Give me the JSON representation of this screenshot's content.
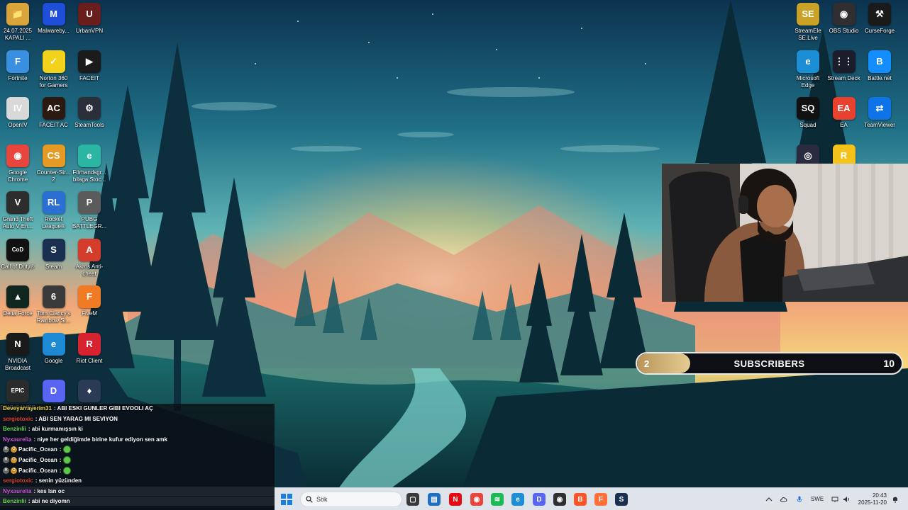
{
  "desktop": {
    "left_icons": [
      {
        "label": "24.07.2025 KAPALI ...",
        "icon": "folder-icon",
        "color": "#d9a53a",
        "glyph": "📁"
      },
      {
        "label": "Malwareby...",
        "icon": "malwarebytes-icon",
        "color": "#1f4fd8",
        "glyph": "M"
      },
      {
        "label": "UrbanVPN",
        "icon": "urbanvpn-icon",
        "color": "#6a1d1d",
        "glyph": "U"
      },
      {
        "label": "Fortnite",
        "icon": "fortnite-icon",
        "color": "#3a8fe0",
        "glyph": "F"
      },
      {
        "label": "Norton 360 for Gamers",
        "icon": "norton-icon",
        "color": "#f2d21a",
        "glyph": "✓"
      },
      {
        "label": "FACEIT",
        "icon": "faceit-icon",
        "color": "#1b1b1b",
        "glyph": "▶"
      },
      {
        "label": "OpenIV",
        "icon": "openiv-icon",
        "color": "#d9d9d9",
        "glyph": "IV"
      },
      {
        "label": "FACEIT AC",
        "icon": "faceit-ac-icon",
        "color": "#2b1a12",
        "glyph": "AC"
      },
      {
        "label": "SteamTools",
        "icon": "steamtools-icon",
        "color": "#2a2f3a",
        "glyph": "⚙"
      },
      {
        "label": "Google Chrome",
        "icon": "chrome-icon",
        "color": "#e8453c",
        "glyph": "◉"
      },
      {
        "label": "Counter-Str... 2",
        "icon": "cs2-icon",
        "color": "#e49a25",
        "glyph": "CS"
      },
      {
        "label": "Förhandsgr... bilaga Stoc...",
        "icon": "edge-icon",
        "color": "#2bb5a3",
        "glyph": "e"
      },
      {
        "label": "Grand Theft Auto V En...",
        "icon": "gta-icon",
        "color": "#2d2d2d",
        "glyph": "V"
      },
      {
        "label": "Rocket League®",
        "icon": "rocket-league-icon",
        "color": "#2a6fd1",
        "glyph": "RL"
      },
      {
        "label": "PUBG BATTLEGR...",
        "icon": "pubg-icon",
        "color": "#5b5b5b",
        "glyph": "P"
      },
      {
        "label": "Call of Duty®",
        "icon": "cod-icon",
        "color": "#111111",
        "glyph": "CoD"
      },
      {
        "label": "Steam",
        "icon": "steam-icon",
        "color": "#1b3050",
        "glyph": "S"
      },
      {
        "label": "Akros Anti-cheat",
        "icon": "akros-icon",
        "color": "#d43c2b",
        "glyph": "A"
      },
      {
        "label": "Delta Force",
        "icon": "delta-force-icon",
        "color": "#10271f",
        "glyph": "▲"
      },
      {
        "label": "Tom Clancy's Rainbow Si...",
        "icon": "rainbow-six-icon",
        "color": "#3a3a3a",
        "glyph": "6"
      },
      {
        "label": "FiveM",
        "icon": "fivem-icon",
        "color": "#f07b24",
        "glyph": "F"
      },
      {
        "label": "NVIDIA Broadcast",
        "icon": "nvidia-icon",
        "color": "#1a1a1a",
        "glyph": "N"
      },
      {
        "label": "Google",
        "icon": "edge-google-icon",
        "color": "#1f8ad4",
        "glyph": "e"
      },
      {
        "label": "Riot Client",
        "icon": "riot-icon",
        "color": "#d6232f",
        "glyph": "R"
      },
      {
        "label": "EPIC GAMES",
        "icon": "epic-icon",
        "color": "#2b2b2b",
        "glyph": "EPIC"
      },
      {
        "label": "",
        "icon": "discord-icon",
        "color": "#5865f2",
        "glyph": "D"
      },
      {
        "label": "",
        "icon": "rocket-game-icon",
        "color": "#2b3a55",
        "glyph": "♦"
      }
    ],
    "right_icons": [
      {
        "label": "StreamEle SE.Live",
        "icon": "streamelements-icon",
        "color": "#c9a227",
        "glyph": "SE"
      },
      {
        "label": "OBS Studio",
        "icon": "obs-icon",
        "color": "#302e31",
        "glyph": "◉"
      },
      {
        "label": "CurseForge",
        "icon": "curseforge-icon",
        "color": "#1a1a1a",
        "glyph": "⚒"
      },
      {
        "label": "Microsoft Edge",
        "icon": "ms-edge-icon",
        "color": "#1c8ed6",
        "glyph": "e"
      },
      {
        "label": "Stream Deck",
        "icon": "stream-deck-icon",
        "color": "#1b1d2b",
        "glyph": "⋮⋮"
      },
      {
        "label": "Battle.net",
        "icon": "battlenet-icon",
        "color": "#148eff",
        "glyph": "B"
      },
      {
        "label": "Squad",
        "icon": "squad-icon",
        "color": "#111111",
        "glyph": "SQ"
      },
      {
        "label": "EA",
        "icon": "ea-icon",
        "color": "#e8422f",
        "glyph": "EA"
      },
      {
        "label": "TeamViewer",
        "icon": "teamviewer-icon",
        "color": "#0e73e6",
        "glyph": "⇄"
      },
      {
        "label": "",
        "icon": "ubisoft-icon",
        "color": "#2a2a40",
        "glyph": "◎"
      },
      {
        "label": "",
        "icon": "rockstar-icon",
        "color": "#f3c21b",
        "glyph": "R"
      }
    ]
  },
  "subscribers": {
    "label": "SUBSCRIBERS",
    "current": "2",
    "goal": "10",
    "progress_fraction": 0.2
  },
  "chat": [
    {
      "user": "Deveyarrayerim31",
      "user_color": "#e8d34b",
      "msg": ": ABI ESKI GUNLER GIBI EVOOLI AÇ",
      "badges": []
    },
    {
      "user": "sergiotoxic",
      "user_color": "#e0412f",
      "msg": ": ABI SEN YARAG MI SEVIYON",
      "badges": []
    },
    {
      "user": "Benzinlii",
      "user_color": "#6cd85a",
      "msg": ": abi kurmamışsın ki",
      "badges": []
    },
    {
      "user": "Nyxaurelia",
      "user_color": "#c65ad9",
      "msg": ": niye her geldiğimde birine kufur ediyon sen amk",
      "badges": []
    },
    {
      "user": "Pacific_Ocean",
      "user_color": "#ffffff",
      "msg": ":",
      "badges": [
        "R",
        "O"
      ],
      "emote": true
    },
    {
      "user": "Pacific_Ocean",
      "user_color": "#ffffff",
      "msg": ":",
      "badges": [
        "R",
        "O"
      ],
      "emote": true
    },
    {
      "user": "Pacific_Ocean",
      "user_color": "#ffffff",
      "msg": ":",
      "badges": [
        "R",
        "O"
      ],
      "emote": true
    },
    {
      "user": "sergiotoxic",
      "user_color": "#e0412f",
      "msg": ": senin yüzünden",
      "badges": []
    },
    {
      "user": "Nyxaurelia",
      "user_color": "#c65ad9",
      "msg": ": kes lan oc",
      "badges": []
    },
    {
      "user": "Benzinlii",
      "user_color": "#6cd85a",
      "msg": ": abi ne diyomn",
      "badges": []
    }
  ],
  "taskbar": {
    "search_placeholder": "Sök",
    "apps": [
      {
        "icon": "task-view-icon",
        "color": "#3a3a3a",
        "glyph": "▢"
      },
      {
        "icon": "file-explorer-icon",
        "color": "#1e6fbf",
        "glyph": "▤"
      },
      {
        "icon": "netflix-icon",
        "color": "#e50914",
        "glyph": "N"
      },
      {
        "icon": "chrome-taskbar-icon",
        "color": "#e8453c",
        "glyph": "◉"
      },
      {
        "icon": "spotify-icon",
        "color": "#1db954",
        "glyph": "≋"
      },
      {
        "icon": "edge-taskbar-icon",
        "color": "#1c8ed6",
        "glyph": "e"
      },
      {
        "icon": "discord-taskbar-icon",
        "color": "#5865f2",
        "glyph": "D"
      },
      {
        "icon": "obs-taskbar-icon",
        "color": "#302e31",
        "glyph": "◉"
      },
      {
        "icon": "brave-icon",
        "color": "#fb542b",
        "glyph": "B"
      },
      {
        "icon": "firefox-icon",
        "color": "#ff7139",
        "glyph": "F"
      },
      {
        "icon": "steam-taskbar-icon",
        "color": "#1b3050",
        "glyph": "S"
      }
    ],
    "language": "SWE",
    "time": "20:43",
    "date": "2025-11-20"
  }
}
